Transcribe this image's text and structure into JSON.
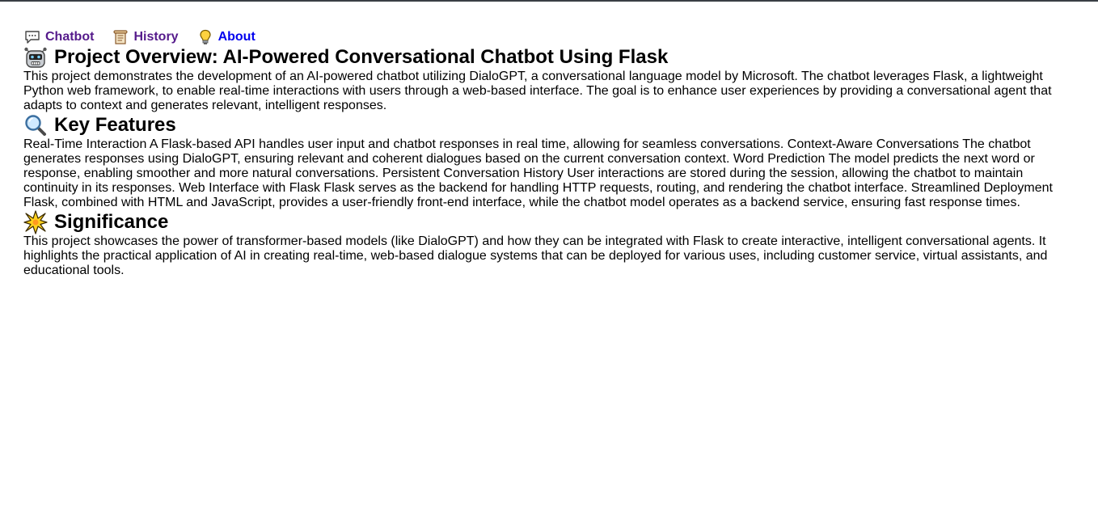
{
  "nav": {
    "items": [
      {
        "label": "Chatbot",
        "icon": "speech-bubble-icon"
      },
      {
        "label": "History",
        "icon": "scroll-icon"
      },
      {
        "label": "About",
        "icon": "lightbulb-icon"
      }
    ]
  },
  "sections": {
    "overview": {
      "icon": "robot-icon",
      "title": "Project Overview: AI-Powered Conversational Chatbot Using Flask",
      "text": "This project demonstrates the development of an AI-powered chatbot utilizing DialoGPT, a conversational language model by Microsoft. The chatbot leverages Flask, a lightweight Python web framework, to enable real-time interactions with users through a web-based interface. The goal is to enhance user experiences by providing a conversational agent that adapts to context and generates relevant, intelligent responses."
    },
    "features": {
      "icon": "magnifying-glass-icon",
      "title": "Key Features",
      "text": "Real-Time Interaction A Flask-based API handles user input and chatbot responses in real time, allowing for seamless conversations. Context-Aware Conversations The chatbot generates responses using DialoGPT, ensuring relevant and coherent dialogues based on the current conversation context. Word Prediction The model predicts the next word or response, enabling smoother and more natural conversations. Persistent Conversation History User interactions are stored during the session, allowing the chatbot to maintain continuity in its responses. Web Interface with Flask Flask serves as the backend for handling HTTP requests, routing, and rendering the chatbot interface. Streamlined Deployment Flask, combined with HTML and JavaScript, provides a user-friendly front-end interface, while the chatbot model operates as a backend service, ensuring fast response times."
    },
    "significance": {
      "icon": "sparkle-icon",
      "title": "Significance",
      "text": "This project showcases the power of transformer-based models (like DialoGPT) and how they can be integrated with Flask to create interactive, intelligent conversational agents. It highlights the practical application of AI in creating real-time, web-based dialogue systems that can be deployed for various uses, including customer service, virtual assistants, and educational tools."
    }
  }
}
